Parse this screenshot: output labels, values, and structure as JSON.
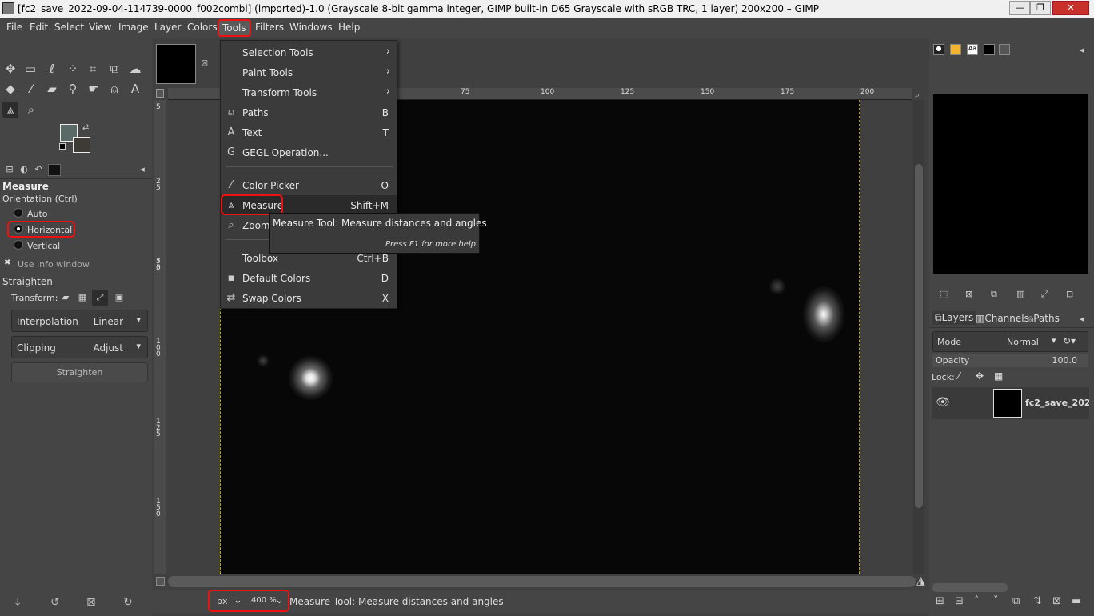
{
  "window": {
    "title": "[fc2_save_2022-09-04-114739-0000_f002combi] (imported)-1.0 (Grayscale 8-bit gamma integer, GIMP built-in D65 Grayscale with sRGB TRC, 1 layer) 200x200 – GIMP",
    "minimize": "—",
    "maximize": "❐",
    "close": "✕"
  },
  "menubar": [
    "File",
    "Edit",
    "Select",
    "View",
    "Image",
    "Layer",
    "Colors",
    "Tools",
    "Filters",
    "Windows",
    "Help"
  ],
  "tools_menu": {
    "items": [
      {
        "label": "Selection Tools",
        "shortcut": "",
        "submenu": true,
        "icon": ""
      },
      {
        "label": "Paint Tools",
        "shortcut": "",
        "submenu": true,
        "icon": ""
      },
      {
        "label": "Transform Tools",
        "shortcut": "",
        "submenu": true,
        "icon": ""
      },
      {
        "label": "Paths",
        "shortcut": "B",
        "icon": "⍝"
      },
      {
        "label": "Text",
        "shortcut": "T",
        "icon": "A"
      },
      {
        "label": "GEGL Operation...",
        "shortcut": "",
        "icon": "G"
      },
      {
        "label": "Color Picker",
        "shortcut": "O",
        "icon": "⁄"
      },
      {
        "label": "Measure",
        "shortcut": "Shift+M",
        "icon": "⩓"
      },
      {
        "label": "Zoom",
        "shortcut": "",
        "icon": "⌕"
      },
      {
        "label": "Toolbox",
        "shortcut": "Ctrl+B",
        "icon": ""
      },
      {
        "label": "Default Colors",
        "shortcut": "D",
        "icon": "▪"
      },
      {
        "label": "Swap Colors",
        "shortcut": "X",
        "icon": "⇄"
      }
    ]
  },
  "tooltip": {
    "text": "Measure Tool: Measure distances and angles",
    "help": "Press F1 for more help"
  },
  "tool_options": {
    "title": "Measure",
    "orientation_label": "Orientation  (Ctrl)",
    "orientation_options": [
      "Auto",
      "Horizontal",
      "Vertical"
    ],
    "selected": "Horizontal",
    "use_info_window": "Use info window",
    "straighten_heading": "Straighten",
    "transform_label": "Transform:",
    "interpolation_label": "Interpolation",
    "interpolation_value": "Linear",
    "clipping_label": "Clipping",
    "clipping_value": "Adjust",
    "straighten_button": "Straighten"
  },
  "ruler": {
    "h_ticks": [
      "75",
      "100",
      "125",
      "150",
      "175",
      "200"
    ],
    "v_ticks": [
      "5",
      "2\n5",
      "5\n0",
      "7\n5",
      "1\n0\n0",
      "1\n2\n5",
      "1\n5\n0"
    ]
  },
  "statusbar": {
    "unit": "px",
    "zoom": "400 %",
    "message": "Measure Tool: Measure distances and angles"
  },
  "layers_panel": {
    "tabs": [
      "Layers",
      "Channels",
      "Paths"
    ],
    "mode_label": "Mode",
    "mode_value": "Normal",
    "opacity_label": "Opacity",
    "opacity_value": "100.0",
    "opacity_fraction": 1.0,
    "lock_label": "Lock:",
    "layer_name": "fc2_save_202"
  },
  "colors": {
    "accent_highlight": "#e11111",
    "foreground": "#5a6b67",
    "background": "#3e3a36"
  }
}
